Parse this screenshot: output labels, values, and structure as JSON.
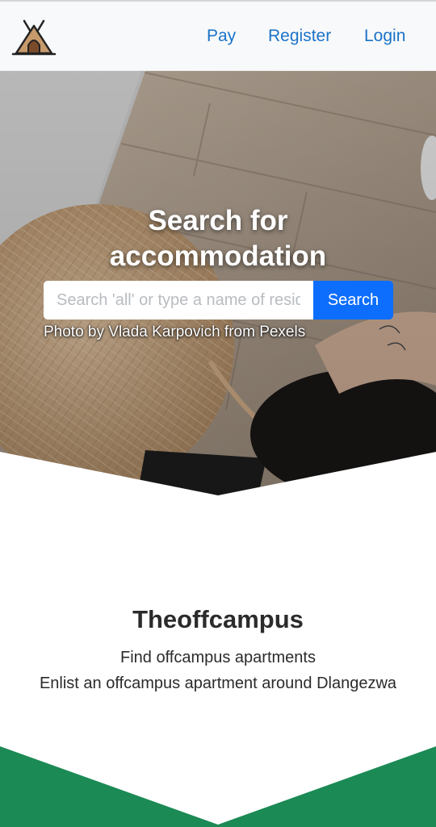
{
  "nav": {
    "links": [
      {
        "label": "Pay"
      },
      {
        "label": "Register"
      },
      {
        "label": "Login"
      }
    ]
  },
  "hero": {
    "title_line1": "Search for",
    "title_line2": "accommodation",
    "search": {
      "placeholder": "Search 'all' or type a name of residence",
      "value": "",
      "button_label": "Search"
    },
    "photo_credit": "Photo by Vlada Karpovich from Pexels"
  },
  "about": {
    "title": "Theoffcampus",
    "lines": [
      "Find offcampus apartments",
      "Enlist an offcampus apartment around Dlangezwa"
    ]
  },
  "colors": {
    "primary": "#0d6efd",
    "link": "#1a73c8",
    "footer_green": "#1b8a55",
    "navbar_bg": "#f8f9fa"
  },
  "icons": {
    "logo": "tent-icon"
  }
}
